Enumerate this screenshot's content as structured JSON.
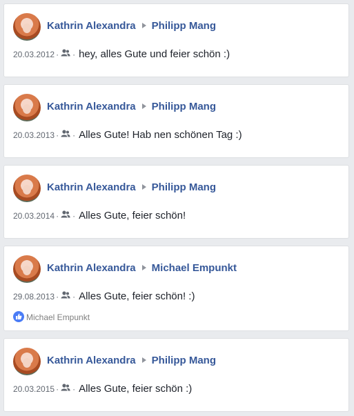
{
  "posts": [
    {
      "author": "Kathrin Alexandra",
      "recipient": "Philipp Mang",
      "date": "20.03.2012",
      "message": "hey, alles Gute und feier schön :)"
    },
    {
      "author": "Kathrin Alexandra",
      "recipient": "Philipp Mang",
      "date": "20.03.2013",
      "message": "Alles Gute! Hab nen schönen Tag :)"
    },
    {
      "author": "Kathrin Alexandra",
      "recipient": "Philipp Mang",
      "date": "20.03.2014",
      "message": "Alles Gute, feier schön!"
    },
    {
      "author": "Kathrin Alexandra",
      "recipient": "Michael Empunkt",
      "date": "29.08.2013",
      "message": "Alles Gute, feier schön! :)",
      "liked_by": "Michael Empunkt"
    },
    {
      "author": "Kathrin Alexandra",
      "recipient": "Philipp Mang",
      "date": "20.03.2015",
      "message": "Alles Gute, feier schön :)"
    }
  ],
  "meta_separator": "·",
  "icons": {
    "audience": "friends-icon",
    "arrow": "triangle-right-icon",
    "like": "thumbs-up-icon"
  },
  "colors": {
    "name_link": "#365899",
    "background": "#e9ebee",
    "like_badge": "#4a7cf6"
  }
}
